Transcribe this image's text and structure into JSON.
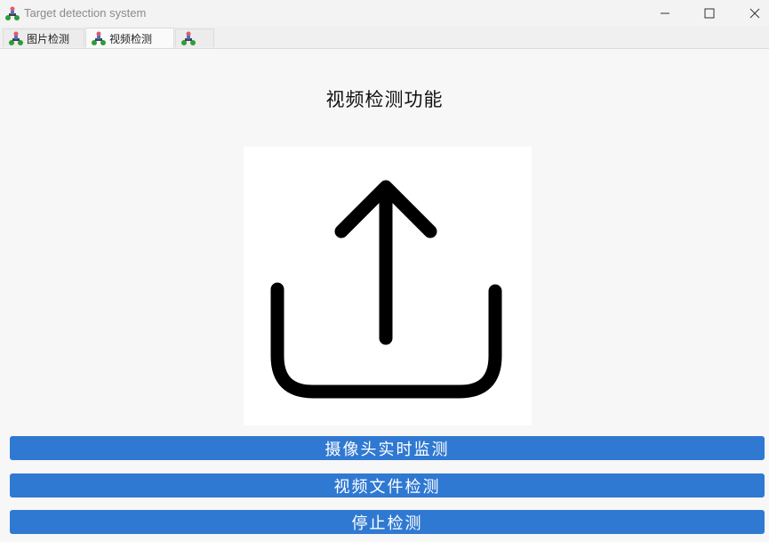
{
  "window": {
    "title": "Target detection system",
    "icon": "scooter-icon"
  },
  "tabs": [
    {
      "label": "图片检测",
      "icon": "scooter-icon",
      "active": false
    },
    {
      "label": "视频检测",
      "icon": "scooter-icon",
      "active": true
    },
    {
      "label": "",
      "icon": "scooter-icon",
      "active": false
    }
  ],
  "main": {
    "title": "视频检测功能",
    "upload_icon": "upload-icon",
    "buttons": {
      "camera": "摄像头实时监测",
      "file": "视频文件检测",
      "stop": "停止检测"
    }
  },
  "colors": {
    "button_bg": "#3079d2",
    "button_text": "#ffffff",
    "background": "#f7f7f7"
  }
}
